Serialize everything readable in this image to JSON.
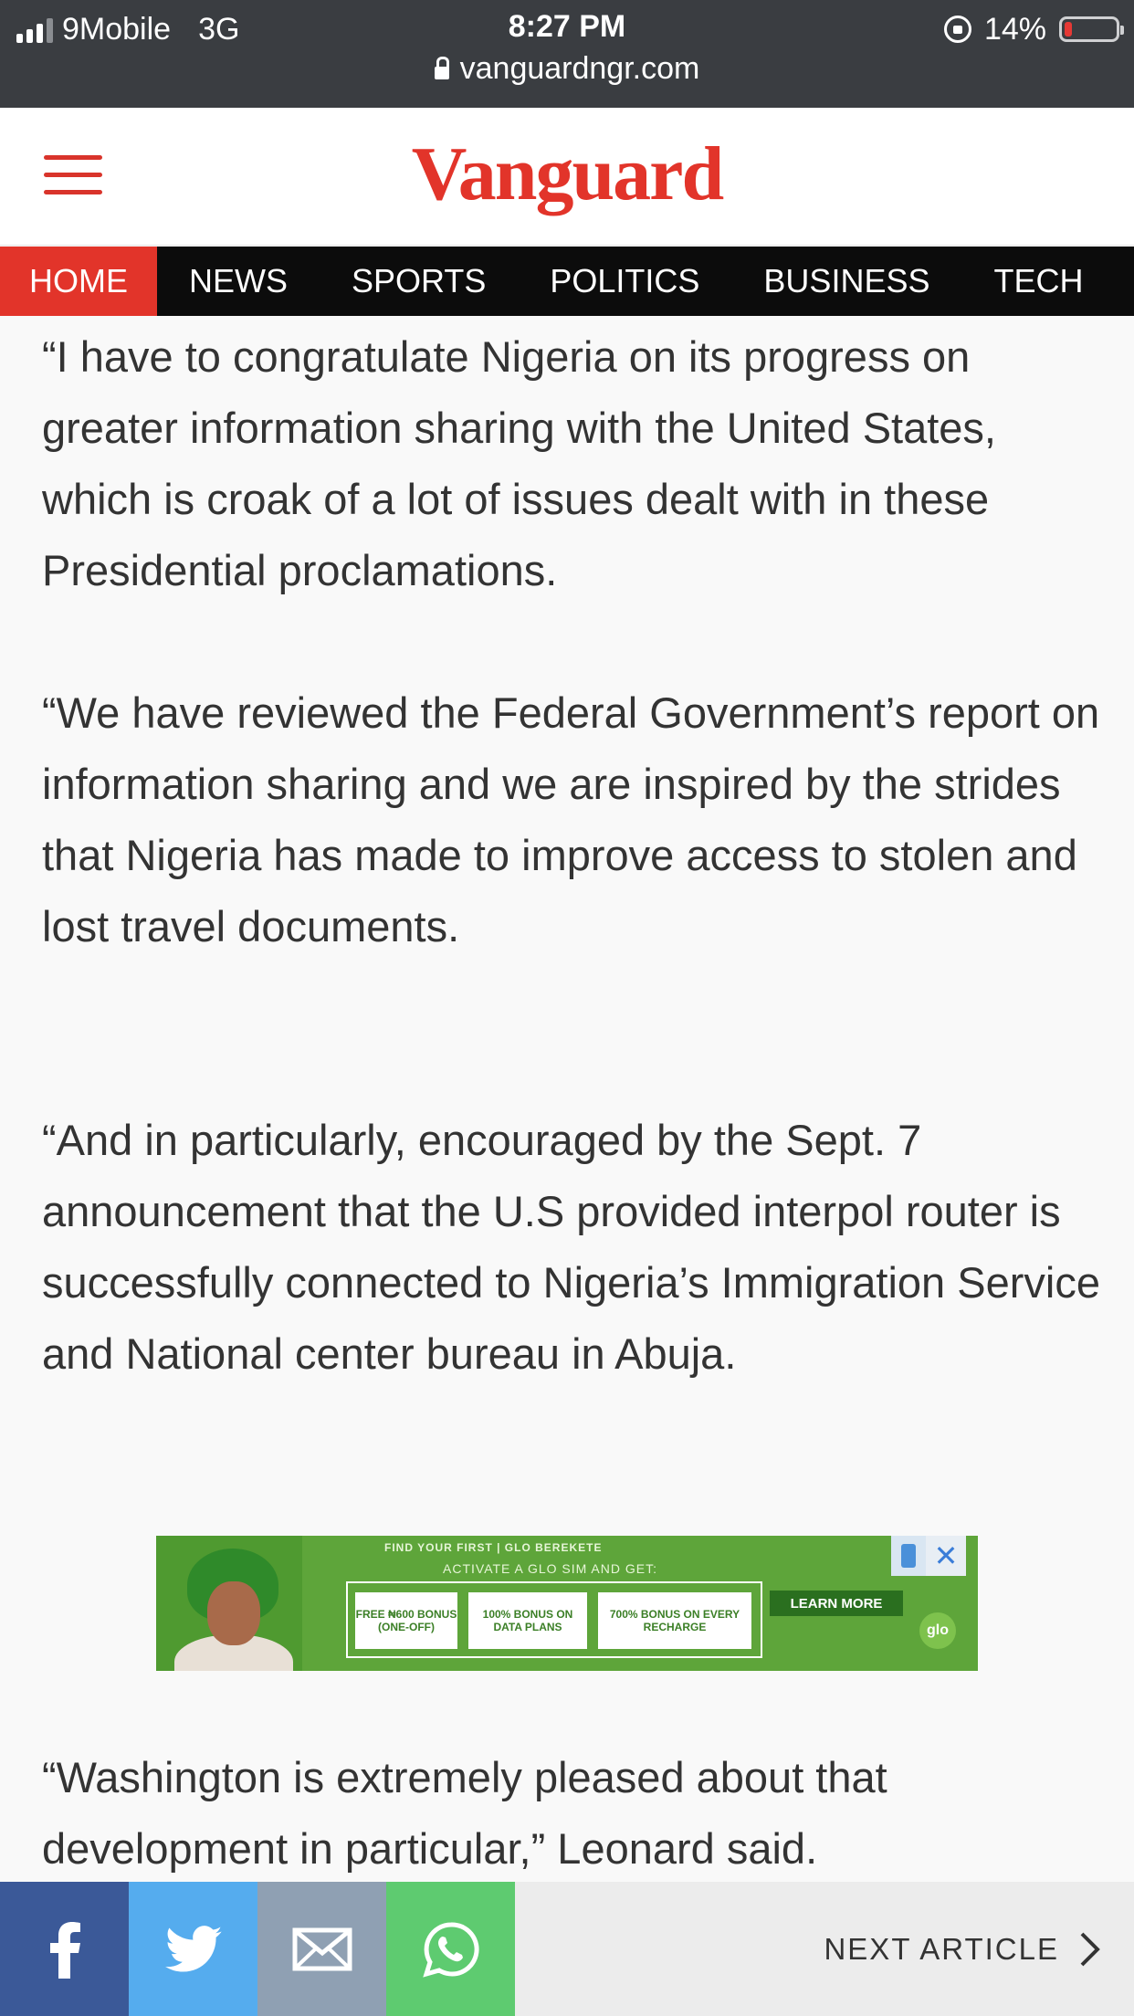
{
  "status_bar": {
    "carrier": "9Mobile",
    "network": "3G",
    "time": "8:27 PM",
    "battery_percent": "14%",
    "battery_level": 0.14,
    "battery_color": "#e53935",
    "url": "vanguardngr.com"
  },
  "header": {
    "logo_text": "Vanguard",
    "brand_color": "#e2342a"
  },
  "nav": {
    "items": [
      "HOME",
      "NEWS",
      "SPORTS",
      "POLITICS",
      "BUSINESS",
      "TECH"
    ],
    "active": "HOME"
  },
  "article": {
    "paragraphs": [
      "“I have to congratulate Nigeria on its progress on greater information sharing with the United States, which is croak of a lot of issues dealt with in these Presidential proclamations.",
      "“We have reviewed the Federal Government’s report on information sharing and we are inspired by the strides that Nigeria has made to improve access to stolen and lost travel documents.",
      "“And in particularly, encouraged by the Sept. 7 announcement that the U.S provided interpol router is successfully connected to Nigeria’s Immigration Service and National center bureau in Abuja.",
      "“Washington is extremely pleased about that development in particular,” Leonard said."
    ]
  },
  "ad": {
    "top_line": "FIND YOUR FIRST  |  GLO BEREKETE",
    "sub_line": "ACTIVATE A GLO SIM AND GET:",
    "offers": [
      "FREE ₦600 BONUS (ONE-OFF)",
      "100% BONUS ON DATA PLANS",
      "700% BONUS ON EVERY RECHARGE"
    ],
    "cta": "LEARN MORE",
    "brand": "glo"
  },
  "share_bar": {
    "buttons": [
      "facebook-icon",
      "twitter-icon",
      "email-icon",
      "whatsapp-icon"
    ],
    "next_article": "NEXT ARTICLE"
  }
}
